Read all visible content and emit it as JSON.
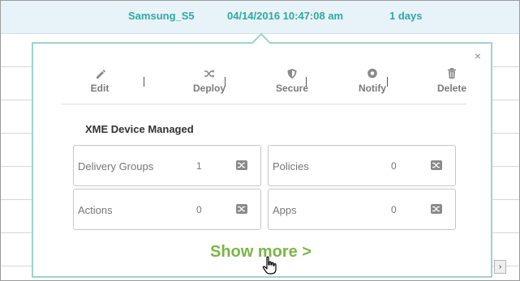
{
  "device_row": {
    "name": "Samsung_S5",
    "timestamp": "04/14/2016 10:47:08 am",
    "duration": "1 days"
  },
  "popup": {
    "close_label": "×",
    "actions": [
      {
        "label": "Edit",
        "icon": "pencil-icon"
      },
      {
        "label": "Deploy",
        "icon": "shuffle-icon"
      },
      {
        "label": "Secure",
        "icon": "shield-icon"
      },
      {
        "label": "Notify",
        "icon": "record-icon"
      },
      {
        "label": "Delete",
        "icon": "trash-icon"
      }
    ],
    "separator": "|",
    "section_title": "XME Device Managed",
    "cards": [
      {
        "label": "Delivery Groups",
        "count": "1"
      },
      {
        "label": "Policies",
        "count": "0"
      },
      {
        "label": "Actions",
        "count": "0"
      },
      {
        "label": "Apps",
        "count": "0"
      }
    ],
    "show_more": "Show more >"
  },
  "scrollbar": {
    "right_arrow": "›"
  },
  "colors": {
    "accent_teal": "#2ea9a2",
    "show_more_green": "#7ab648",
    "popup_border": "#9ed2ce",
    "row_highlight": "#e7f3f8"
  }
}
